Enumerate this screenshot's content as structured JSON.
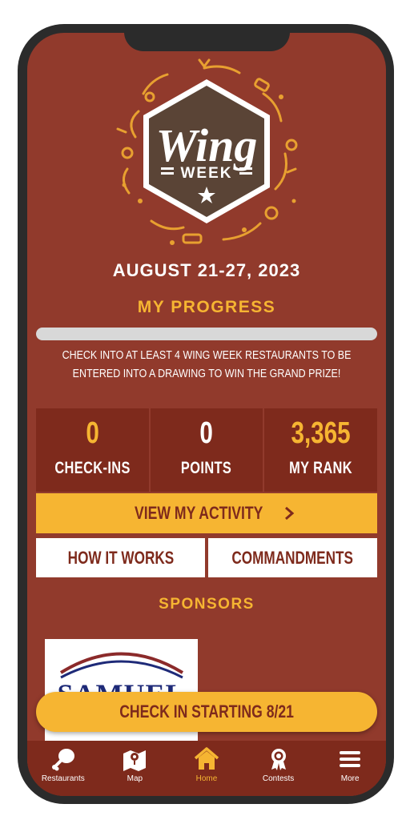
{
  "event_dates": "AUGUST 21-27, 2023",
  "logo": {
    "line1": "Wing",
    "line2": "WEEK"
  },
  "progress": {
    "title": "MY PROGRESS",
    "fraction": 0,
    "instructions": "CHECK INTO AT LEAST 4 WING WEEK RESTAURANTS TO BE ENTERED INTO A DRAWING TO WIN THE GRAND PRIZE!"
  },
  "stats": [
    {
      "value": "0",
      "label": "CHECK-INS"
    },
    {
      "value": "0",
      "label": "POINTS"
    },
    {
      "value": "3,365",
      "label": "MY RANK"
    }
  ],
  "buttons": {
    "view_activity": "VIEW MY ACTIVITY",
    "how_it_works": "HOW IT WORKS",
    "commandments": "COMMANDMENTS",
    "check_in": "CHECK IN STARTING 8/21"
  },
  "sponsors": {
    "title": "SPONSORS",
    "logo_text": "SAMUEL"
  },
  "tabs": [
    {
      "label": "Restaurants",
      "icon": "drumstick-icon"
    },
    {
      "label": "Map",
      "icon": "map-icon"
    },
    {
      "label": "Home",
      "icon": "home-icon",
      "active": true
    },
    {
      "label": "Contests",
      "icon": "award-icon"
    },
    {
      "label": "More",
      "icon": "menu-icon"
    }
  ],
  "colors": {
    "background": "#913a2c",
    "dark": "#7e2a1c",
    "accent": "#f6b532"
  }
}
